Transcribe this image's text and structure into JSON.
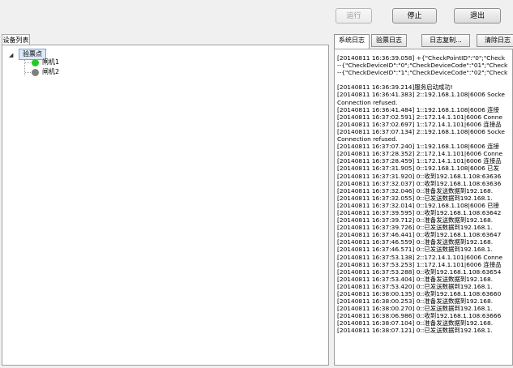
{
  "toolbar": {
    "run_label": "运行",
    "stop_label": "停止",
    "exit_label": "退出"
  },
  "left_panel": {
    "tab_label": "设备列表",
    "tree": {
      "root_label": "验票点",
      "nodes": [
        {
          "label": "闸机1",
          "status_color": "#22cc22"
        },
        {
          "label": "闸机2",
          "status_color": "#808080"
        }
      ]
    }
  },
  "right_panel": {
    "tabs": [
      {
        "label": "系统日志"
      },
      {
        "label": "验票日志"
      },
      {
        "label": "日志复制..."
      },
      {
        "label": "清除日志"
      }
    ],
    "log_lines": [
      "[20140811 16:36:39.058] +{\"CheckPointID\":\"0\";\"Check",
      "--{\"CheckDeviceID\":\"0\";\"CheckDeviceCode\":\"01\";\"Check",
      "--{\"CheckDeviceID\":\"1\";\"CheckDeviceCode\":\"02\";\"Check",
      "",
      "[20140811 16:36:39.214]服务启动成功!",
      "[20140811 16:36:41.383] 2::192.168.1.108|6006 Socke",
      "Connection refused.",
      "[20140811 16:36:41.484] 1::192.168.1.108|6006 连接",
      "[20140811 16:37:02.591] 2::172.14.1.101|6006 Conne",
      "[20140811 16:37:02.697] 1::172.14.1.101|6006 连接品",
      "[20140811 16:37:07.134] 2::192.168.1.108|6006 Socke",
      "Connection refused.",
      "[20140811 16:37:07.240] 1::192.168.1.108|6006 连接",
      "[20140811 16:37:28.352] 2::172.14.1.101|6006 Conne",
      "[20140811 16:37:28.459] 1::172.14.1.101|6006 连接品",
      "[20140811 16:37:31.905] 0::192.168.1.108|6006 已发",
      "[20140811 16:37:31.920] 0::收到192.168.1.108:63636",
      "[20140811 16:37:32.037] 0::收到192.168.1.108:63636",
      "[20140811 16:37:32.046] 0::准备发送数据到192.168.",
      "[20140811 16:37:32.055] 0::已发送数据到192.168.1.",
      "[20140811 16:37:32.014] 0::192.168.1.108|6006 已接",
      "[20140811 16:37:39.595] 0::收到192.168.1.108:63642",
      "[20140811 16:37:39.712] 0::准备发送数据到192.168.",
      "[20140811 16:37:39.726] 0::已发送数据到192.168.1.",
      "[20140811 16:37:46.441] 0::收到192.168.1.108:63647",
      "[20140811 16:37:46.559] 0::准备发送数据到192.168.",
      "[20140811 16:37:46.571] 0::已发送数据到192.168.1.",
      "[20140811 16:37:53.138] 2::172.14.1.101|6006 Conne",
      "[20140811 16:37:53.253] 1::172.14.1.101|6006 连接品",
      "[20140811 16:37:53.288] 0::收到192.168.1.108:63654",
      "[20140811 16:37:53.404] 0::准备发送数据到192.168.",
      "[20140811 16:37:53.420] 0::已发送数据到192.168.1.",
      "[20140811 16:38:00.135] 0::收到192.168.1.108:63660",
      "[20140811 16:38:00.253] 0::准备发送数据到192.168.",
      "[20140811 16:38:00.270] 0::已发送数据到192.168.1.",
      "[20140811 16:38:06.986] 0::收到192.168.1.108:63666",
      "[20140811 16:38:07.104] 0::准备发送数据到192.168.",
      "[20140811 16:38:07.121] 0::已发送数据到192.168.1."
    ]
  }
}
